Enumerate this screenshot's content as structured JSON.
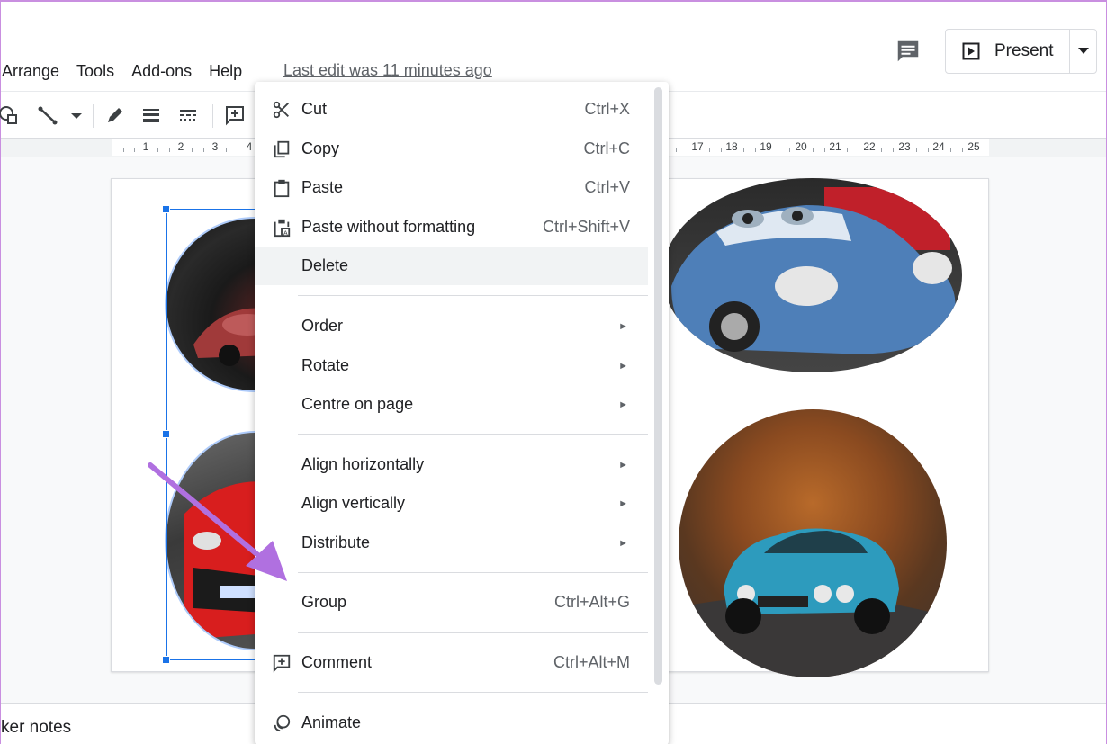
{
  "menubar": {
    "items": [
      "Arrange",
      "Tools",
      "Add-ons",
      "Help"
    ],
    "last_edit": "Last edit was 11 minutes ago"
  },
  "header": {
    "present_label": "Present"
  },
  "ruler": {
    "left_ticks": [
      "1",
      "2",
      "3",
      "4"
    ],
    "right_ticks": [
      "17",
      "18",
      "19",
      "20",
      "21",
      "22",
      "23",
      "24",
      "25"
    ]
  },
  "context_menu": {
    "cut": {
      "label": "Cut",
      "shortcut": "Ctrl+X",
      "icon": "scissors-icon"
    },
    "copy": {
      "label": "Copy",
      "shortcut": "Ctrl+C",
      "icon": "copy-icon"
    },
    "paste": {
      "label": "Paste",
      "shortcut": "Ctrl+V",
      "icon": "clipboard-icon"
    },
    "paste_plain": {
      "label": "Paste without formatting",
      "shortcut": "Ctrl+Shift+V",
      "icon": "clipboard-text-icon"
    },
    "delete": {
      "label": "Delete"
    },
    "order": {
      "label": "Order"
    },
    "rotate": {
      "label": "Rotate"
    },
    "centre": {
      "label": "Centre on page"
    },
    "align_h": {
      "label": "Align horizontally"
    },
    "align_v": {
      "label": "Align vertically"
    },
    "distribute": {
      "label": "Distribute"
    },
    "group": {
      "label": "Group",
      "shortcut": "Ctrl+Alt+G"
    },
    "comment": {
      "label": "Comment",
      "shortcut": "Ctrl+Alt+M",
      "icon": "add-comment-icon"
    },
    "animate": {
      "label": "Animate",
      "icon": "animate-icon"
    }
  },
  "notes": {
    "label": "ker notes"
  },
  "colors": {
    "accent": "#1a73e8",
    "menu_highlight": "#f1f3f4",
    "annotation_arrow": "#b070e0"
  }
}
